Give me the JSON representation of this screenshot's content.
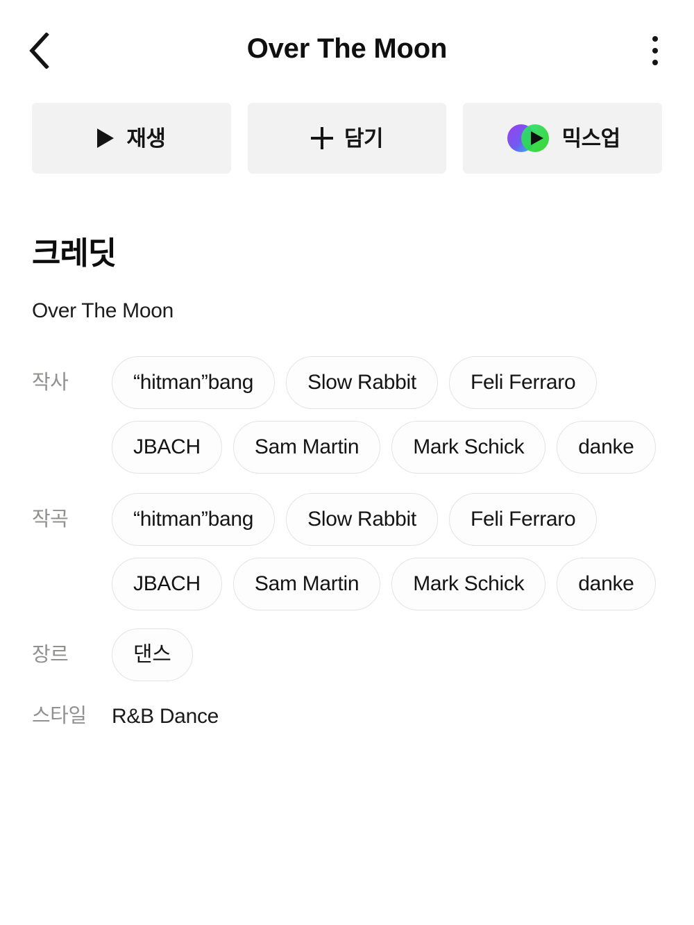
{
  "header": {
    "title": "Over The Moon",
    "back_icon": "chevron-left-icon",
    "more_icon": "kebab-menu-icon"
  },
  "actions": [
    {
      "id": "play",
      "label": "재생",
      "icon": "play-icon"
    },
    {
      "id": "save",
      "label": "담기",
      "icon": "plus-icon"
    },
    {
      "id": "mixup",
      "label": "믹스업",
      "icon": "mixup-icon"
    }
  ],
  "credits": {
    "section_title": "크레딧",
    "track_name": "Over The Moon",
    "rows": [
      {
        "id": "lyricist",
        "label": "작사",
        "type": "chips",
        "values": [
          "“hitman”bang",
          "Slow Rabbit",
          "Feli Ferraro",
          "JBACH",
          "Sam Martin",
          "Mark Schick",
          "danke"
        ]
      },
      {
        "id": "composer",
        "label": "작곡",
        "type": "chips",
        "values": [
          "“hitman”bang",
          "Slow Rabbit",
          "Feli Ferraro",
          "JBACH",
          "Sam Martin",
          "Mark Schick",
          "danke"
        ]
      },
      {
        "id": "genre",
        "label": "장르",
        "type": "chips",
        "values": [
          "댄스"
        ]
      },
      {
        "id": "style",
        "label": "스타일",
        "type": "text",
        "values": [
          "R&B Dance"
        ]
      }
    ]
  },
  "colors": {
    "background": "#ffffff",
    "text_primary": "#141414",
    "text_label": "#90908f",
    "button_bg": "#f2f2f3",
    "chip_border": "#e3e3e3",
    "mixup_purple": "#8b3fe8",
    "mixup_cyan": "#22c6e8",
    "mixup_green": "#2fd94a"
  }
}
